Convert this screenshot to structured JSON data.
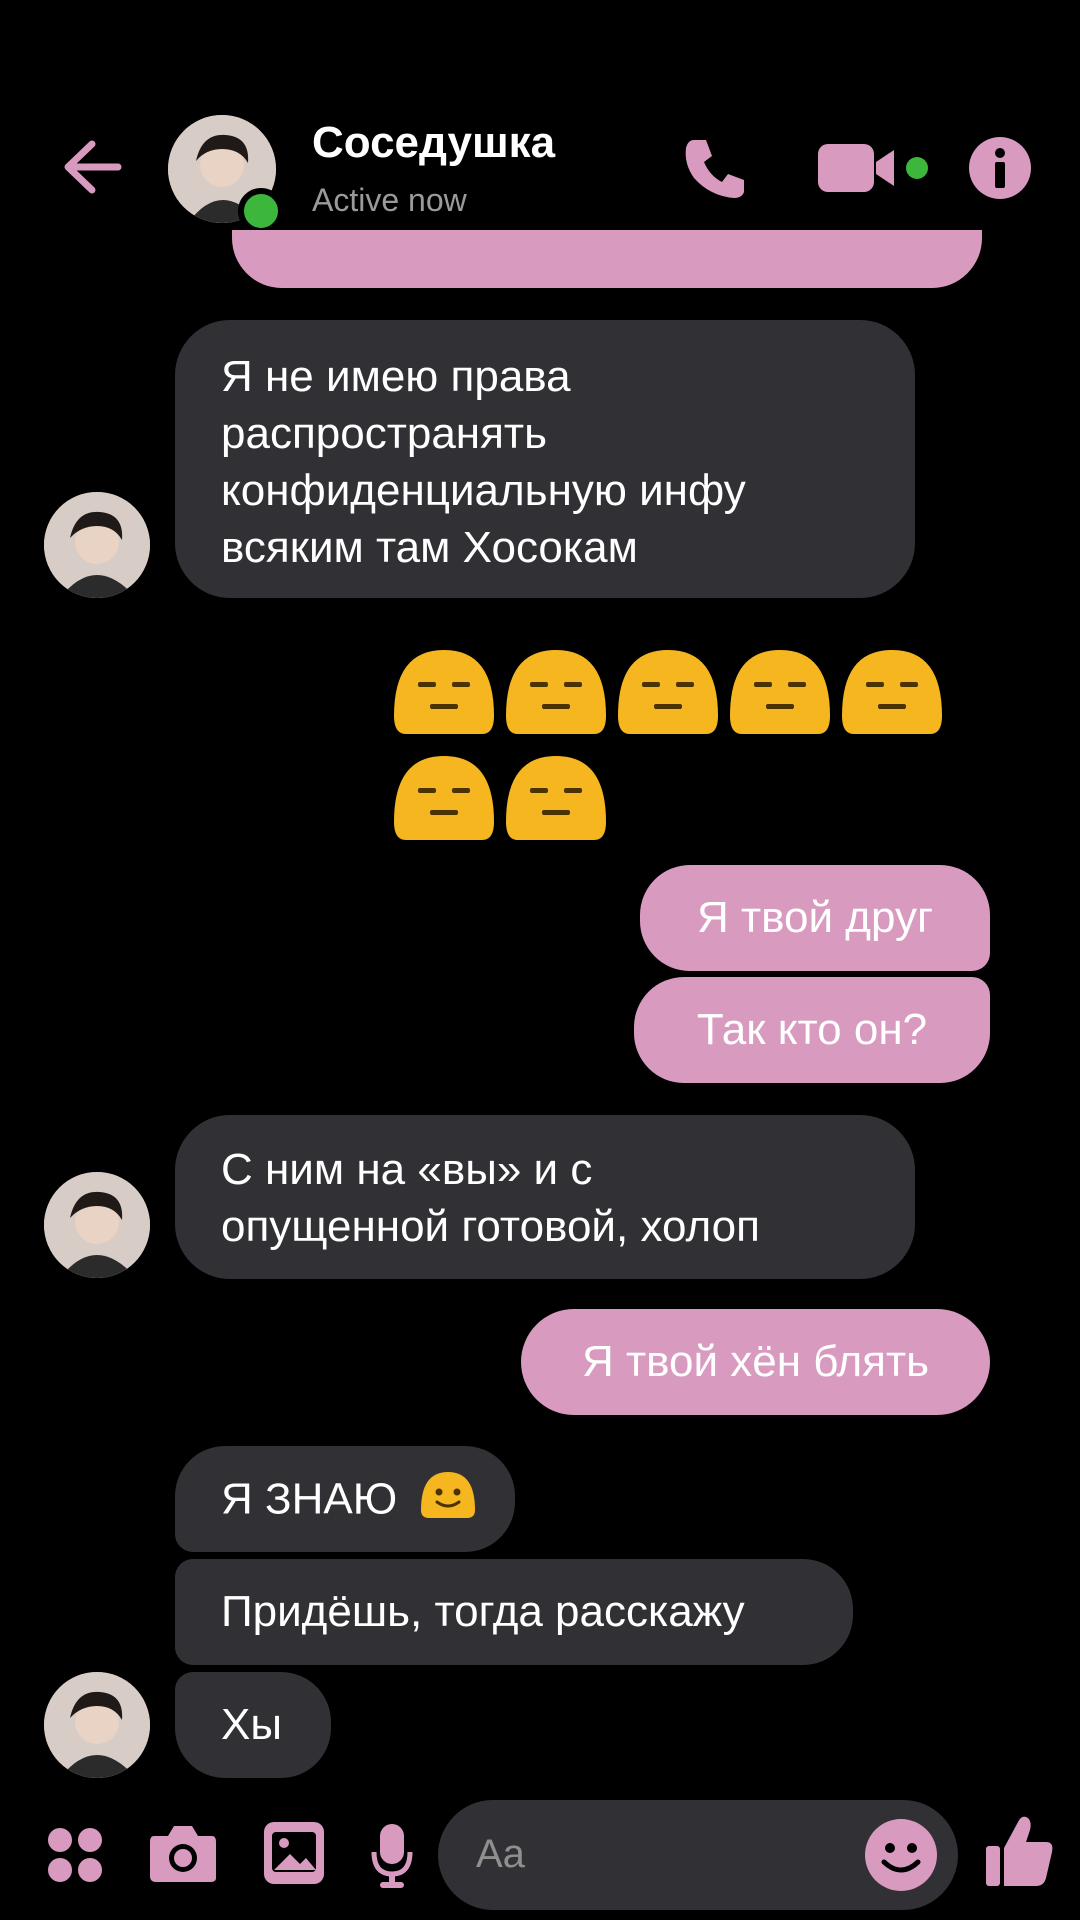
{
  "header": {
    "contact_name": "Соседушка",
    "status": "Active now"
  },
  "messages": [
    {
      "side": "in",
      "text": "Я не имею права\nраспространять\nконфиденциальную инфу\nвсяким там Хосокам"
    },
    {
      "side": "out",
      "emoji": "expressionless-face",
      "count": 7
    },
    {
      "side": "out",
      "text": "Я твой друг"
    },
    {
      "side": "out",
      "text": "Так кто он?"
    },
    {
      "side": "in",
      "text": "С ним на «вы» и с\nопущенной готовой, холоп"
    },
    {
      "side": "out",
      "text": "Я твой хён блять"
    },
    {
      "side": "in",
      "text": "Я ЗНАЮ",
      "emoji": "slightly-smiling-face"
    },
    {
      "side": "in",
      "text": "Придёшь, тогда расскажу"
    },
    {
      "side": "in",
      "text": "Хы"
    }
  ],
  "composer": {
    "placeholder": "Aa"
  },
  "colors": {
    "accent": "#d89bbf",
    "incoming_bubble": "#313034",
    "background": "#000000",
    "online": "#3cb73c",
    "emoji_yellow": "#f6b61f"
  },
  "icons": [
    "back-arrow-icon",
    "phone-icon",
    "video-camera-icon",
    "info-icon",
    "apps-icon",
    "camera-icon",
    "gallery-icon",
    "microphone-icon",
    "emoji-icon",
    "thumbs-up-icon"
  ]
}
